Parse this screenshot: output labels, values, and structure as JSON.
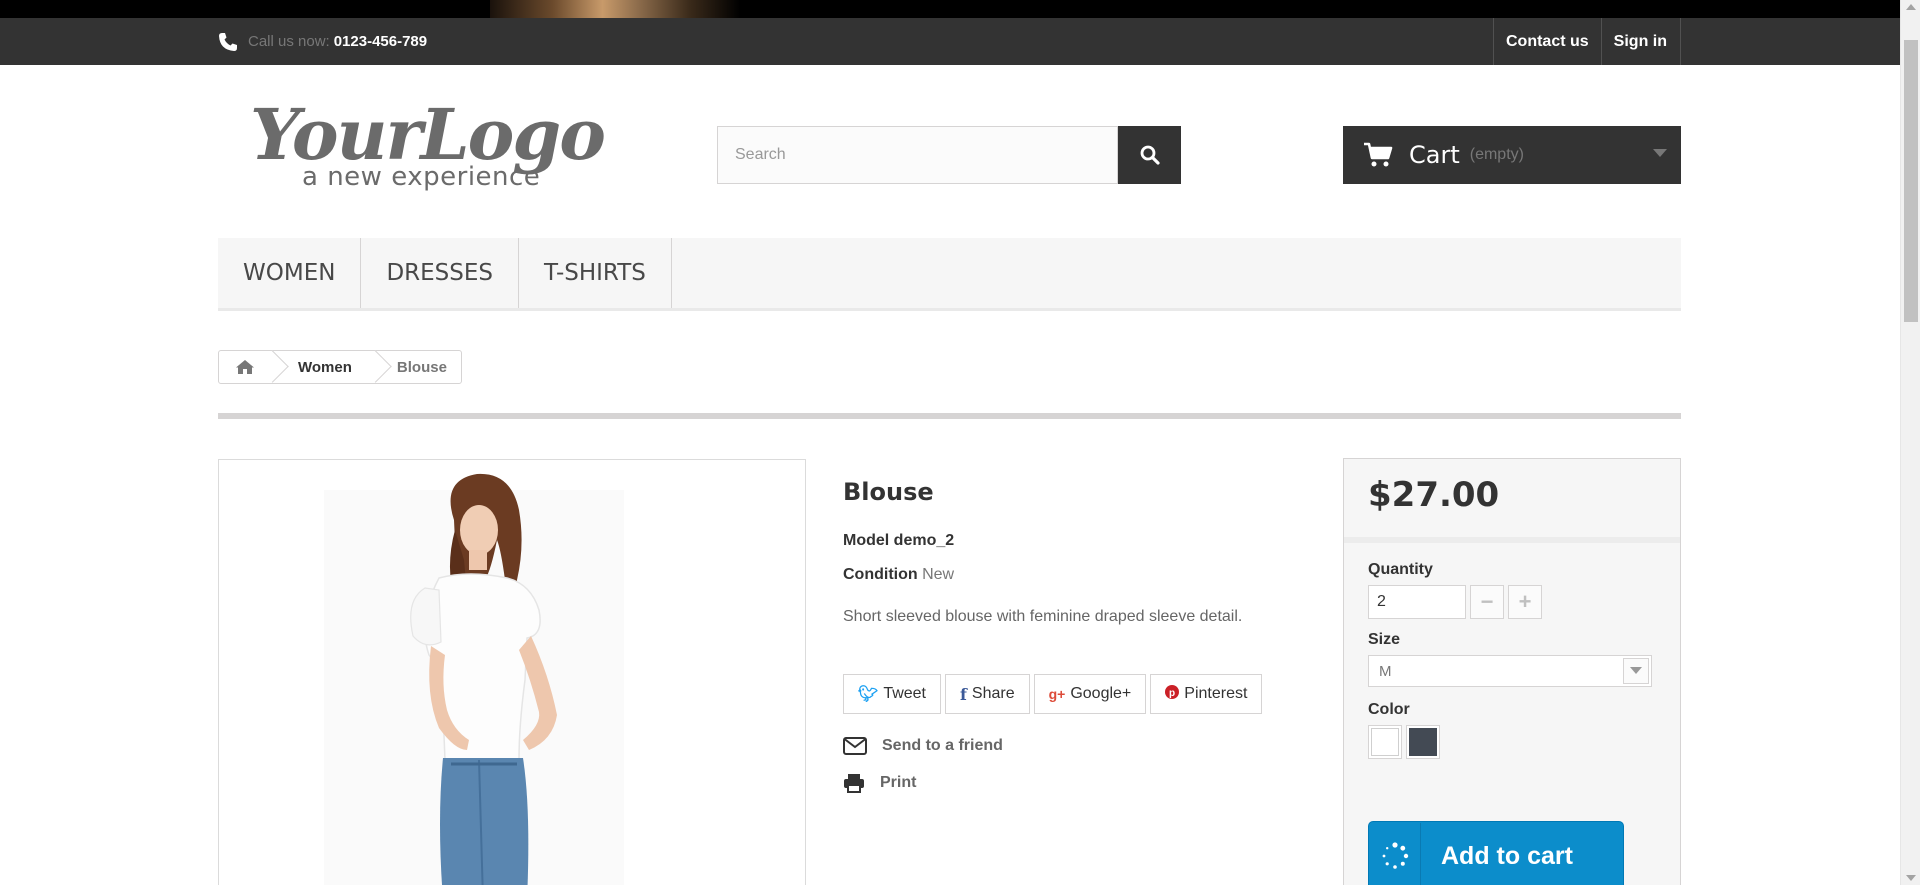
{
  "topbar": {
    "call_label": "Call us now:",
    "phone": "0123-456-789",
    "contact": "Contact us",
    "signin": "Sign in"
  },
  "header": {
    "logo_script": "YourLogo",
    "logo_tagline": "a new experience",
    "search_placeholder": "Search",
    "cart_label": "Cart",
    "cart_status": "(empty)"
  },
  "menu": {
    "items": [
      {
        "label": "WOMEN"
      },
      {
        "label": "DRESSES"
      },
      {
        "label": "T-SHIRTS"
      }
    ]
  },
  "breadcrumb": {
    "items": [
      {
        "label": "Women"
      },
      {
        "label": "Blouse"
      }
    ]
  },
  "product": {
    "title": "Blouse",
    "model_label": "Model",
    "model_value": "demo_2",
    "condition_label": "Condition",
    "condition_value": "New",
    "description": "Short sleeved blouse with feminine draped sleeve detail.",
    "social": {
      "tweet": "Tweet",
      "share": "Share",
      "google": "Google+",
      "pinterest": "Pinterest"
    },
    "send_friend": "Send to a friend",
    "print": "Print"
  },
  "buybox": {
    "price": "$27.00",
    "quantity_label": "Quantity",
    "quantity_value": "2",
    "size_label": "Size",
    "size_value": "M",
    "color_label": "Color",
    "colors": [
      "#ffffff",
      "#434a54"
    ],
    "add_to_cart": "Add to cart"
  },
  "colors": {
    "topbar": "#333333",
    "accent_blue": "#0c8dcb"
  }
}
